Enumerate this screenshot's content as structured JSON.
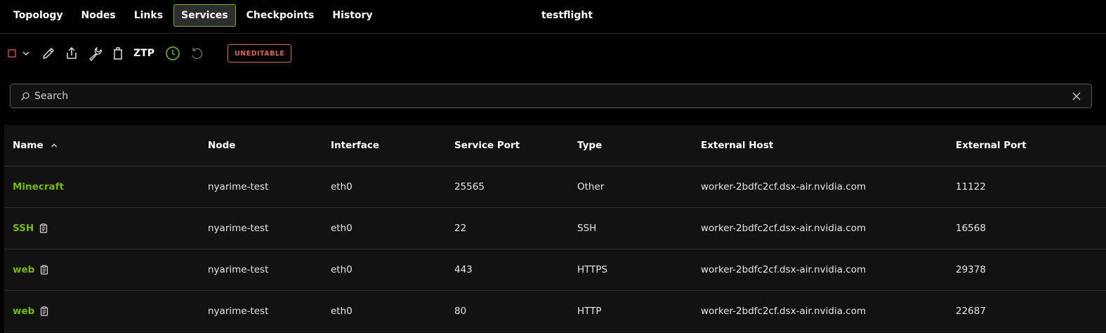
{
  "window": {
    "title": "testflight"
  },
  "tabs": [
    {
      "label": "Topology"
    },
    {
      "label": "Nodes"
    },
    {
      "label": "Links"
    },
    {
      "label": "Services",
      "active": true
    },
    {
      "label": "Checkpoints"
    },
    {
      "label": "History"
    }
  ],
  "toolbar": {
    "icons": [
      "stop-icon",
      "chevron-down-icon",
      "pencil-icon",
      "share-icon",
      "wrench-icon",
      "trash-icon",
      "clock-icon",
      "undo-icon"
    ],
    "ztp_label": "ZTP",
    "badge_label": "UNEDITABLE"
  },
  "search": {
    "placeholder": "Search",
    "value": ""
  },
  "table": {
    "columns": [
      "Name",
      "Node",
      "Interface",
      "Service Port",
      "Type",
      "External Host",
      "External Port"
    ],
    "sort": {
      "column": "Name",
      "direction": "ascending"
    },
    "rows": [
      {
        "name": "Minecraft",
        "copy": false,
        "node": "nyarime-test",
        "interface": "eth0",
        "service_port": "25565",
        "type": "Other",
        "external_host": "worker-2bdfc2cf.dsx-air.nvidia.com",
        "external_port": "11122"
      },
      {
        "name": "SSH",
        "copy": true,
        "node": "nyarime-test",
        "interface": "eth0",
        "service_port": "22",
        "type": "SSH",
        "external_host": "worker-2bdfc2cf.dsx-air.nvidia.com",
        "external_port": "16568"
      },
      {
        "name": "web",
        "copy": true,
        "node": "nyarime-test",
        "interface": "eth0",
        "service_port": "443",
        "type": "HTTPS",
        "external_host": "worker-2bdfc2cf.dsx-air.nvidia.com",
        "external_port": "29378"
      },
      {
        "name": "web",
        "copy": true,
        "node": "nyarime-test",
        "interface": "eth0",
        "service_port": "80",
        "type": "HTTP",
        "external_host": "worker-2bdfc2cf.dsx-air.nvidia.com",
        "external_port": "22687"
      }
    ]
  },
  "colors": {
    "accent": "#76b900",
    "badge": "#e4605a",
    "stop": "#e0484d"
  }
}
